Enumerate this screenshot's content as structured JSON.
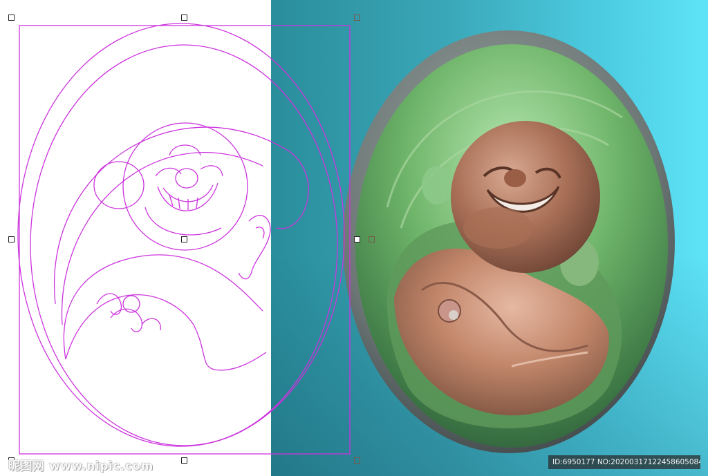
{
  "watermark": {
    "text": "昵图网 www.nipic.com"
  },
  "id_caption": {
    "text": "ID:6950177 NO:20200317122458605084"
  },
  "colors": {
    "vector_stroke": "#cc33dd",
    "viewport_teal_light": "#5ee3f7",
    "viewport_teal_dark": "#2a8d9b",
    "relief_green": "#5fae5a",
    "relief_skin": "#b07a62"
  },
  "icons": {
    "selection_handle": "square-handle-icon"
  }
}
